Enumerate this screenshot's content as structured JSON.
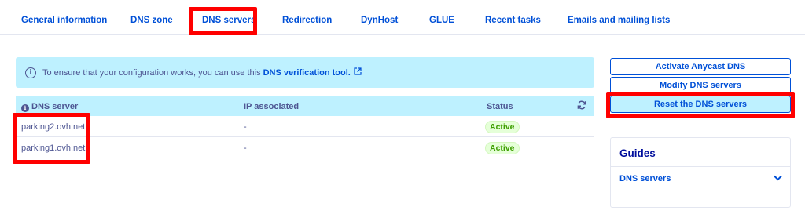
{
  "tabs": {
    "general": "General information",
    "dns_zone": "DNS zone",
    "dns_servers": "DNS servers",
    "redirection": "Redirection",
    "dynhost": "DynHost",
    "glue": "GLUE",
    "recent_tasks": "Recent tasks",
    "emails": "Emails and mailing lists"
  },
  "info": {
    "text": "To ensure that your configuration works, you can use this",
    "link": "DNS verification tool.",
    "icon": "info-icon"
  },
  "table": {
    "headers": {
      "dns_server": "DNS server",
      "ip": "IP associated",
      "status": "Status"
    },
    "rows": [
      {
        "server": "parking2.ovh.net",
        "ip": "-",
        "status": "Active"
      },
      {
        "server": "parking1.ovh.net",
        "ip": "-",
        "status": "Active"
      }
    ]
  },
  "actions": {
    "anycast": "Activate Anycast DNS",
    "modify": "Modify DNS servers",
    "reset": "Reset the DNS servers"
  },
  "guides": {
    "title": "Guides",
    "item": "DNS servers"
  },
  "colors": {
    "accent": "#0050d7",
    "highlight": "#ff0000",
    "info_bg": "#bef1ff",
    "active_badge": "#e5ffd8"
  }
}
